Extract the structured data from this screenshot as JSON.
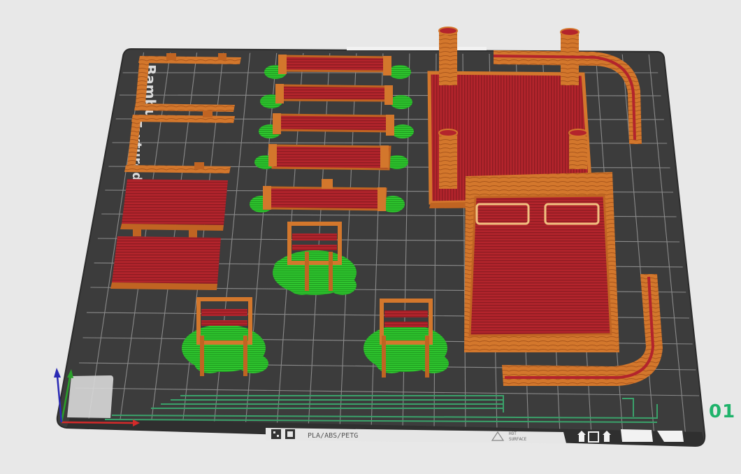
{
  "plate": {
    "brand_text_1": "Bambu",
    "brand_text_2": "Textured",
    "material_label": "PLA/ABS/PETG",
    "hot_surface_line1": "HOT",
    "hot_surface_line2": "SURFACE",
    "plate_number": "01"
  },
  "icons": {
    "axis": "xyz-axis-icon",
    "qr": "qr-code-icon",
    "warning": "hot-surface-warning-icon",
    "nozzle": "plate-orientation-icon"
  },
  "colors": {
    "background": "#e8e8e8",
    "bed": "#3c3c3c",
    "bed_edge": "#2b2b2b",
    "grid": "#8a8a8a",
    "part_top": "#b3242c",
    "part_wall": "#d3772c",
    "part_wall_dark": "#a9561c",
    "support": "#2ec42e",
    "plate_number": "#1fb36b",
    "x_axis": "#d42a2a",
    "y_axis": "#2aa02a",
    "z_axis": "#2a2ab4"
  }
}
